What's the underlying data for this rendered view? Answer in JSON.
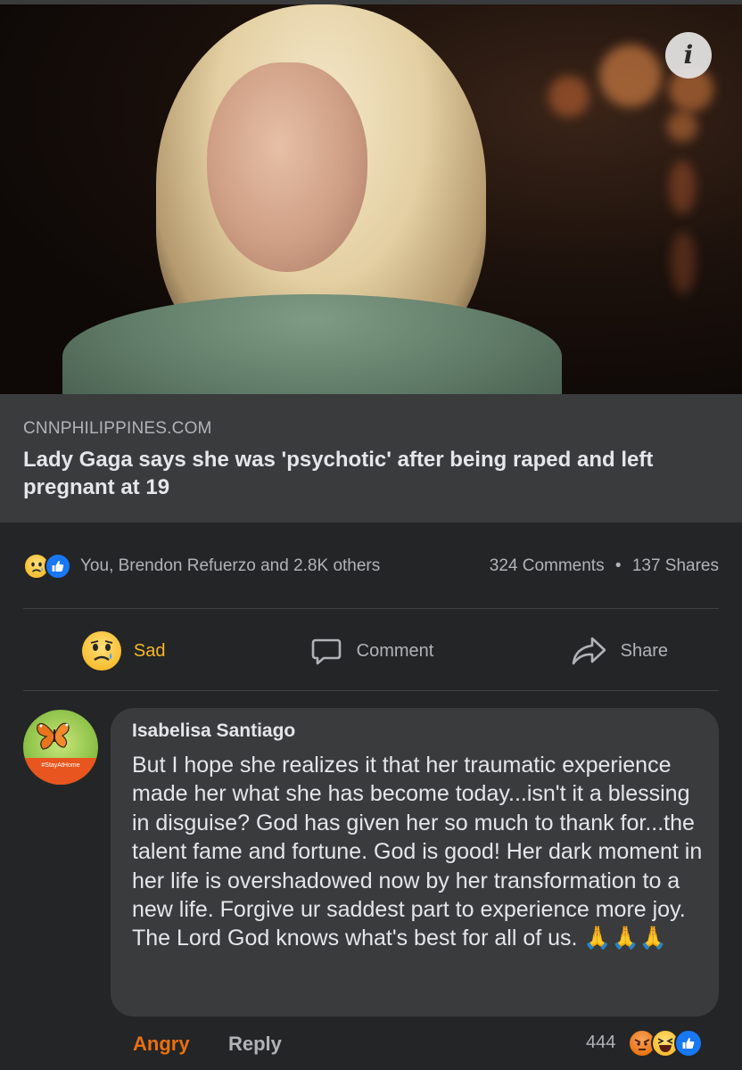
{
  "post": {
    "info_icon_glyph": "i",
    "link_domain": "CNNPHILIPPINES.COM",
    "link_title": "Lady Gaga says she was 'psychotic' after being raped and left pregnant at 19",
    "reactions_summary": "You, Brendon Refuerzo and 2.8K others",
    "reaction_icons": [
      "sad-icon",
      "like-icon"
    ],
    "comments_count": "324 Comments",
    "separator": "•",
    "shares_count": "137 Shares"
  },
  "actions": {
    "sad_label": "Sad",
    "comment_label": "Comment",
    "share_label": "Share"
  },
  "comment": {
    "author": "Isabelisa Santiago",
    "avatar_caption": "#StayAtHome",
    "text": "But I hope she realizes it that her traumatic experience made her what she has become today...isn't it a blessing in disguise? God has given her so much to thank for...the talent fame and fortune. God is good! Her dark moment in her life is overshadowed now by her transformation to a new life. Forgive ur saddest part to experience more joy. The Lord God knows what's best for all of us.  🙏🙏🙏",
    "reaction_label": "Angry",
    "reply_label": "Reply",
    "reaction_count": "444",
    "reaction_icons": [
      "angry-icon",
      "haha-icon",
      "like-icon"
    ]
  },
  "colors": {
    "background": "#242526",
    "link_box": "#3a3b3c",
    "bubble": "#3a3b3c",
    "angry": "#e9710f",
    "sad": "#f7b928",
    "like": "#1877f2",
    "secondary_text": "#b0b3b8"
  }
}
